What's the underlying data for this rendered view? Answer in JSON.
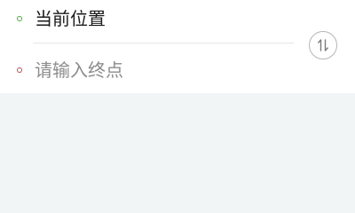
{
  "route": {
    "origin": {
      "value": "当前位置",
      "dot_color": "#3cb034",
      "icon": "start-point-dot-icon"
    },
    "destination": {
      "placeholder": "请输入终点",
      "dot_color": "#c9464a",
      "icon": "end-point-dot-icon"
    },
    "swap_button": {
      "icon": "swap-arrows-icon"
    }
  },
  "colors": {
    "page_background": "#f2f5f5",
    "card_background": "#ffffff",
    "divider": "#e6e6e6",
    "origin_text": "#1b1b1b",
    "placeholder_text": "#8c8c8c"
  }
}
